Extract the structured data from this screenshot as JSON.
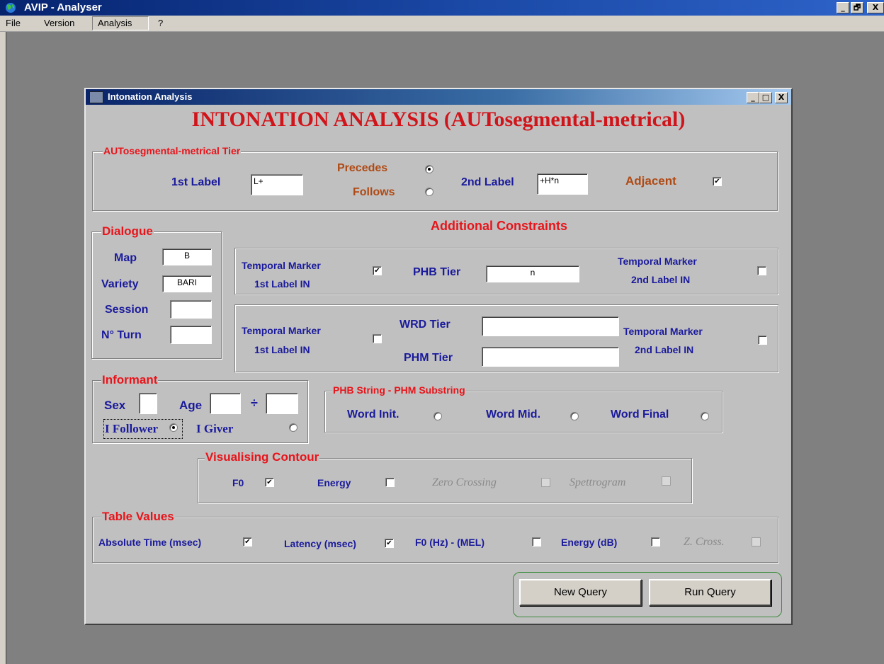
{
  "app": {
    "title": "AVIP - Analyser",
    "caption_buttons": [
      "_",
      "🗗",
      "X"
    ],
    "menu": [
      "File",
      "Version",
      "Analysis",
      "?"
    ]
  },
  "dialog": {
    "title": "Intonation Analysis",
    "caption_buttons": [
      "_",
      "□",
      "X"
    ],
    "heading": "INTONATION ANALYSIS (AUTosegmental-metrical)",
    "tier": {
      "legend": "AUTosegmental-metrical Tier",
      "first_label": "1st Label",
      "first_value": "L+",
      "precedes": "Precedes",
      "follows": "Follows",
      "precedes_selected": true,
      "second_label": "2nd Label",
      "second_value": "+H*n",
      "adjacent": "Adjacent",
      "adjacent_checked": true
    },
    "dialogue": {
      "legend": "Dialogue",
      "map_label": "Map",
      "map_value": "B",
      "variety_label": "Variety",
      "variety_value": "BARI",
      "session_label": "Session",
      "session_value": "",
      "turn_label": "N° Turn",
      "turn_value": ""
    },
    "constraints": {
      "title": "Additional Constraints",
      "tm_line1": "Temporal Marker",
      "tm1_line2": "1st Label  IN",
      "tm2_line2": "2nd Label  IN",
      "box1_tm1_checked": true,
      "box1_tm2_checked": false,
      "phb_label": "PHB Tier",
      "phb_value": "n",
      "box2_tm1_checked": false,
      "box2_tm2_checked": false,
      "wrd_label": "WRD Tier",
      "wrd_value": "",
      "phm_label": "PHM Tier",
      "phm_value": ""
    },
    "informant": {
      "legend": "Informant",
      "sex_label": "Sex",
      "sex_value": "",
      "age_label": "Age",
      "age_from": "",
      "age_sep": "÷",
      "age_to": "",
      "follower_label": "I Follower",
      "giver_label": "I Giver",
      "follower_selected": true
    },
    "phb_string": {
      "legend": "PHB String - PHM Substring",
      "options": [
        "Word Init.",
        "Word Mid.",
        "Word Final"
      ]
    },
    "contour": {
      "legend": "Visualising Contour",
      "f0": "F0",
      "f0_checked": true,
      "energy": "Energy",
      "energy_checked": false,
      "zero": "Zero Crossing",
      "spectro": "Spettrogram"
    },
    "table_values": {
      "legend": "Table Values",
      "abs_time": "Absolute Time (msec)",
      "abs_time_checked": true,
      "latency": "Latency (msec)",
      "latency_checked": true,
      "f0": "F0 (Hz) - (MEL)",
      "energy": "Energy (dB)",
      "zcross": "Z. Cross."
    },
    "buttons": {
      "new_query": "New Query",
      "run_query": "Run Query"
    }
  },
  "colors": {
    "label_blue": "#1a1a9c",
    "legend_red": "#e8141a",
    "heading_red": "#d0141a",
    "brown": "#b04a14",
    "window_gray": "#c0c0c0",
    "desktop_gray": "#808080"
  }
}
